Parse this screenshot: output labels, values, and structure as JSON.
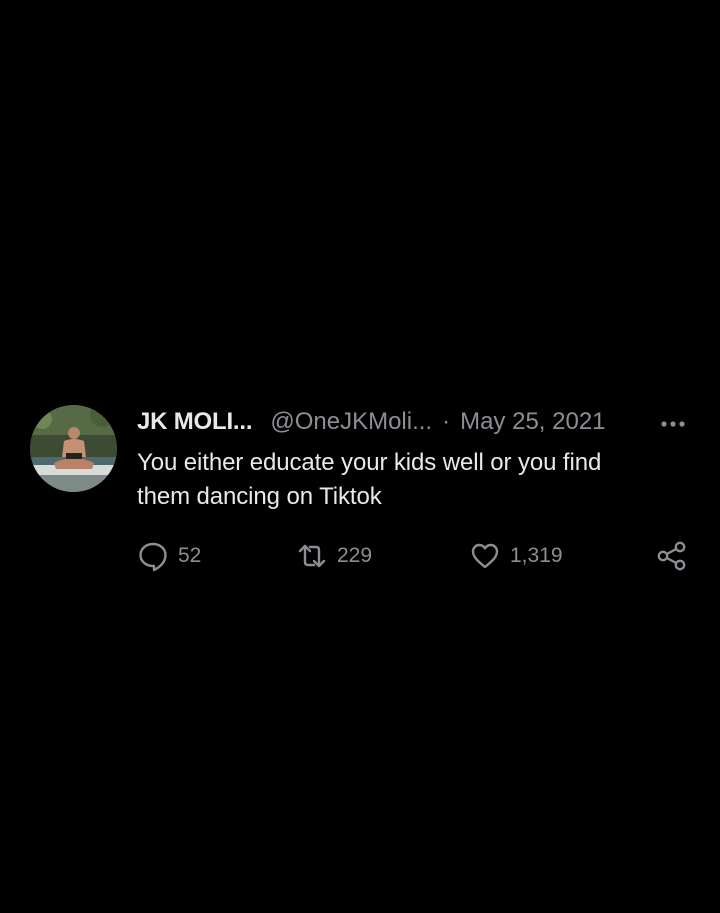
{
  "tweet": {
    "display_name": "JK MOLI...",
    "handle": "@OneJKMoli...",
    "separator": "·",
    "date": "May 25, 2021",
    "text_line1": "You either educate your kids well or you find",
    "text_line2": "them dancing on Tiktok",
    "more_icon": "more-dots-icon",
    "avatar_icon": "avatar"
  },
  "actions": {
    "reply": {
      "icon": "reply-icon",
      "count": "52"
    },
    "retweet": {
      "icon": "retweet-icon",
      "count": "229"
    },
    "like": {
      "icon": "heart-icon",
      "count": "1,319"
    },
    "share": {
      "icon": "share-icon"
    }
  },
  "colors": {
    "background": "#000000",
    "primary_text": "#e7e9ea",
    "secondary_text": "#8b8f94",
    "icon": "#8b8f94"
  }
}
